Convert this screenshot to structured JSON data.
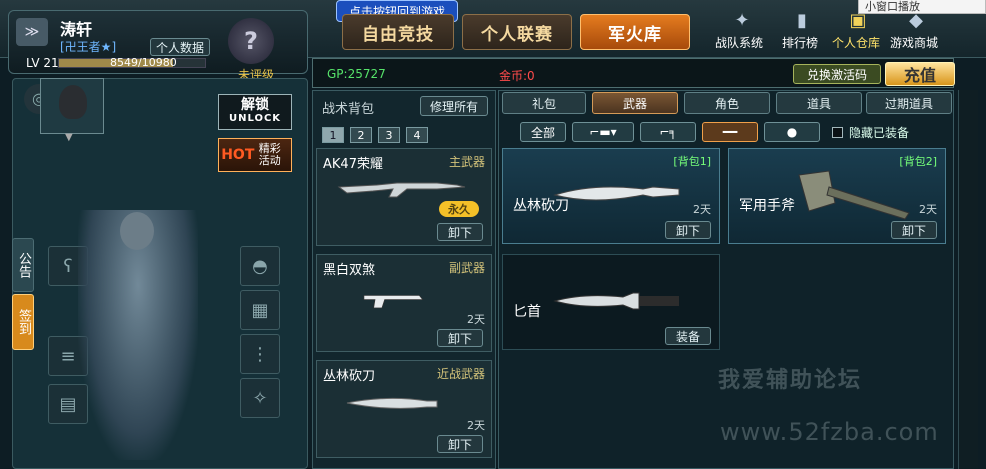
{
  "hint_button": "点击按钮回到游戏",
  "mini_window": "小窗口播放",
  "profile": {
    "name": "涛轩",
    "title": "[卍王者★]",
    "personal_data_btn": "个人数据",
    "level": "LV 21",
    "exp_text": "8549/10980",
    "exp_fraction": 0.78,
    "rating": "未评级"
  },
  "main_tabs": [
    "自由竞技",
    "个人联赛",
    "军火库"
  ],
  "top_links": [
    "战队系统",
    "排行榜",
    "个人仓库",
    "游戏商城"
  ],
  "currency": {
    "gp": "GP:25727",
    "coin": "金币:0",
    "redeem_btn": "兑换激活码",
    "recharge_btn": "充值"
  },
  "left": {
    "unlock_main": "解锁",
    "unlock_sub": "UNLOCK",
    "hot_label": "HOT",
    "hot_text": "精彩活动",
    "side_tabs": [
      "公告",
      "签到"
    ]
  },
  "bag": {
    "title": "战术背包",
    "repair_btn": "修理所有",
    "pages": [
      "1",
      "2",
      "3",
      "4"
    ],
    "items": [
      {
        "name": "AK47荣耀",
        "type": "主武器",
        "badge": "永久",
        "action": "卸下"
      },
      {
        "name": "黑白双煞",
        "type": "副武器",
        "duration": "2天",
        "action": "卸下"
      },
      {
        "name": "丛林砍刀",
        "type": "近战武器",
        "duration": "2天",
        "action": "卸下"
      }
    ]
  },
  "store": {
    "categories": [
      "礼包",
      "武器",
      "角色",
      "道具",
      "过期道具"
    ],
    "subtabs": [
      "全部"
    ],
    "hide_equipped": "隐藏已装备",
    "cards": [
      {
        "name": "丛林砍刀",
        "pack": "[背包1]",
        "duration": "2天",
        "action": "卸下"
      },
      {
        "name": "军用手斧",
        "pack": "[背包2]",
        "duration": "2天",
        "action": "卸下"
      },
      {
        "name": "匕首",
        "action": "装备"
      }
    ]
  },
  "watermark": {
    "line1": "我爱辅助论坛",
    "line2": "www.52fzba.com"
  }
}
